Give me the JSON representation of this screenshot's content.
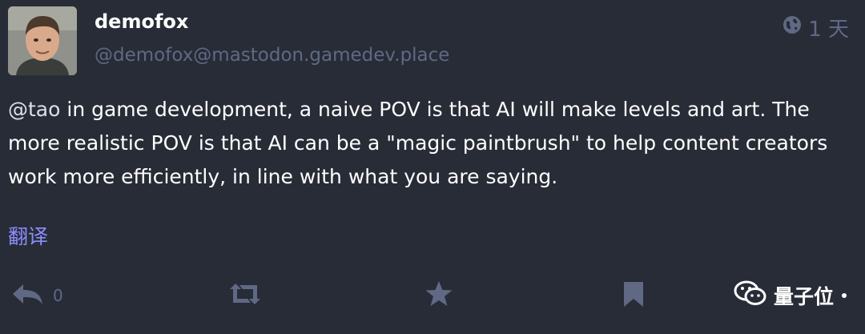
{
  "status": {
    "display_name": "demofox",
    "handle": "@demofox@mastodon.gamedev.place",
    "visibility_icon": "globe-icon",
    "time": "1 天",
    "mention": "@tao",
    "text": " in game development, a naive POV is that AI will make levels and art.  The more realistic POV is that AI can be a \"magic paintbrush\" to help content creators work more efficiently, in line with what you are saying.",
    "translate_label": "翻译"
  },
  "actions": {
    "reply_icon": "reply-icon",
    "reply_count": "0",
    "reblog_icon": "retweet-icon",
    "favourite_icon": "star-icon",
    "bookmark_icon": "bookmark-icon"
  },
  "watermark": {
    "icon": "wechat-icon",
    "label": "量子位"
  },
  "colors": {
    "background": "#282c37",
    "muted": "#606984",
    "link": "#8c8dff",
    "text": "#ffffff"
  }
}
